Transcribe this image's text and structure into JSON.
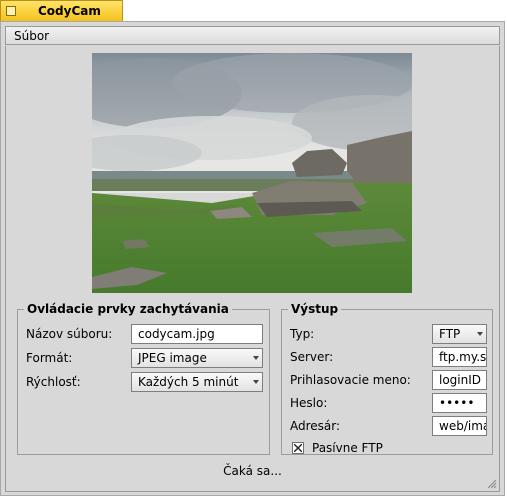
{
  "window": {
    "title": "CodyCam"
  },
  "menu": {
    "file": "Súbor"
  },
  "preview": {
    "description_icon": "webcam-preview-image"
  },
  "capture": {
    "legend": "Ovládacie prvky zachytávania",
    "filename_label": "Názov súboru:",
    "filename_value": "codycam.jpg",
    "format_label": "Formát:",
    "format_value": "JPEG image",
    "speed_label": "Rýchlosť:",
    "speed_value": "Každých 5 minút"
  },
  "output": {
    "legend": "Výstup",
    "type_label": "Typ:",
    "type_value": "FTP",
    "server_label": "Server:",
    "server_value": "ftp.my.s",
    "login_label": "Prihlasovacie meno:",
    "login_value": "loginID",
    "password_label": "Heslo:",
    "password_value": "•••••",
    "dir_label": "Adresár:",
    "dir_value": "web/ima",
    "passive_label": "Pasívne FTP",
    "passive_checked": true
  },
  "status": {
    "text": "Čaká sa..."
  },
  "colors": {
    "tab": "#f5c21a",
    "window_bg": "#d8d8d8"
  }
}
